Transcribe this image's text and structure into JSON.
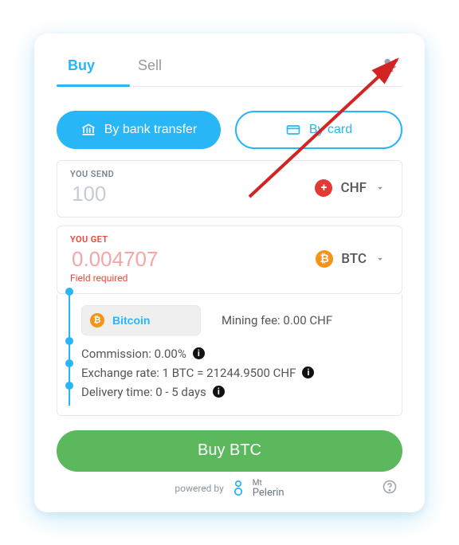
{
  "tabs": {
    "buy": "Buy",
    "sell": "Sell",
    "active": "buy"
  },
  "payment": {
    "bank": "By bank transfer",
    "card": "By card"
  },
  "send": {
    "label": "YOU SEND",
    "value": "100",
    "currency": "CHF"
  },
  "get": {
    "label": "YOU GET",
    "value": "0.004707",
    "currency": "BTC",
    "error": "Field required"
  },
  "network": {
    "name": "Bitcoin",
    "mining_fee_label": "Mining fee: 0.00 CHF"
  },
  "fees": {
    "commission": "Commission: 0.00%",
    "rate": "Exchange rate: 1 BTC = 21244.9500 CHF",
    "delivery": "Delivery time: 0 - 5 days"
  },
  "action": "Buy BTC",
  "footer": {
    "powered": "powered by",
    "brand1": "Mt",
    "brand2": "Pelerin"
  }
}
